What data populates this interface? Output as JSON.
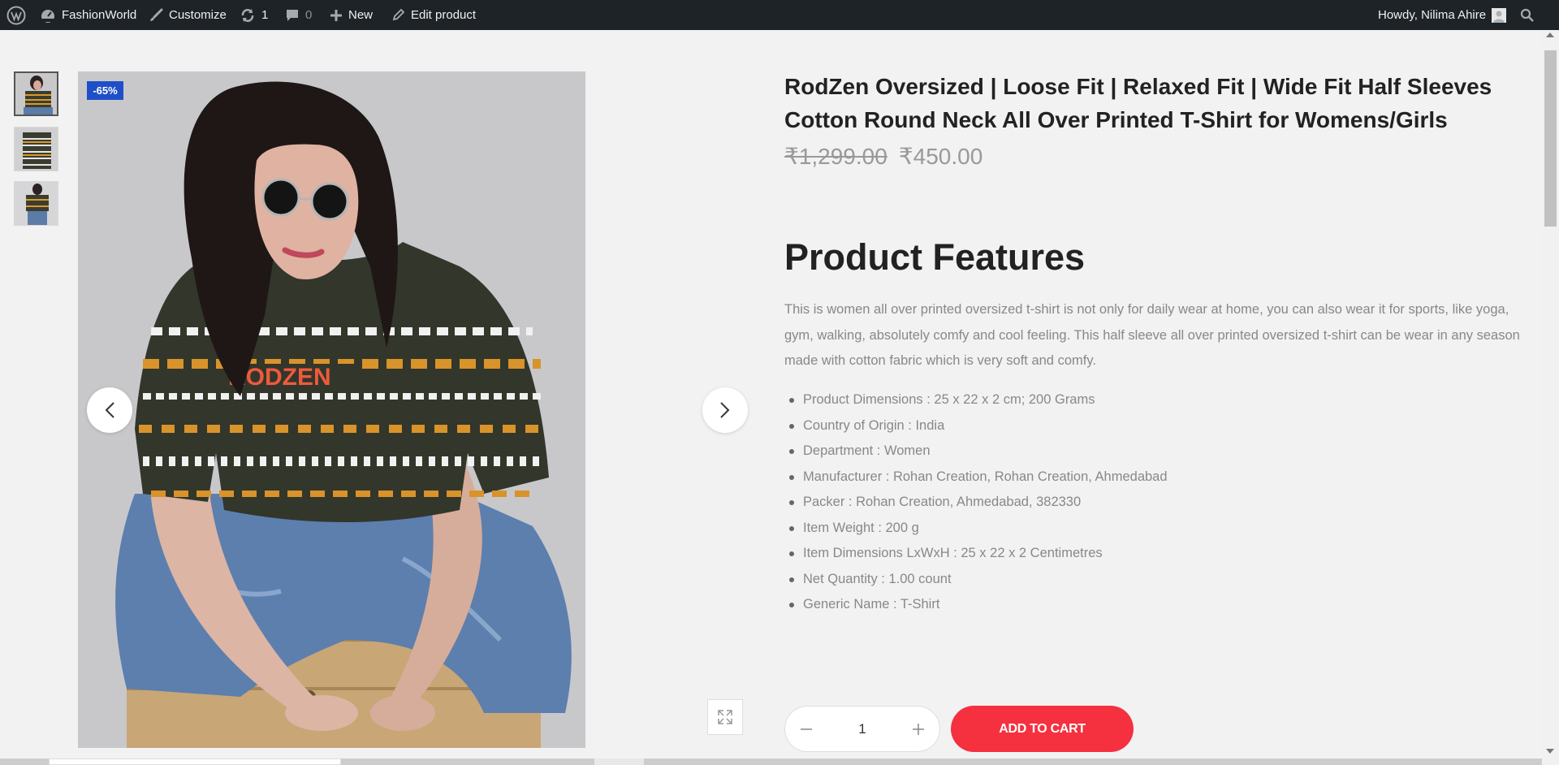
{
  "adminbar": {
    "site_name": "FashionWorld",
    "customize": "Customize",
    "updates_count": "1",
    "comments_count": "0",
    "new_label": "New",
    "edit_label": "Edit product",
    "howdy": "Howdy, Nilima Ahire"
  },
  "gallery": {
    "discount_badge": "-65%"
  },
  "product": {
    "title_line1": "RodZen Oversized | Loose Fit | Relaxed Fit | Wide Fit Half Sleeves",
    "title_line2": "Cotton Round Neck All Over Printed T-Shirt for Womens/Girls",
    "price_old": "₹1,299.00",
    "price_new": "₹450.00",
    "features_heading": "Product Features",
    "description": "This is women all over printed oversized t-shirt is not only for daily wear at home, you can also wear it for sports, like yoga, gym, walking, absolutely comfy and cool feeling. This half sleeve all over printed oversized t-shirt can be wear in any season made with cotton fabric which is very soft and comfy.",
    "specs": [
      "Product Dimensions  :  25 x 22 x 2 cm; 200 Grams",
      "Country of Origin  :  India",
      "Department  :  Women",
      "Manufacturer  :  Rohan Creation, Rohan Creation, Ahmedabad",
      "Packer  :  Rohan Creation, Ahmedabad, 382330",
      "Item Weight  :  200 g",
      "Item Dimensions LxWxH  :  25 x 22 x 2 Centimetres",
      "Net Quantity  :  1.00 count",
      "Generic Name  :  T-Shirt"
    ],
    "quantity": "1",
    "add_to_cart": "ADD TO CART"
  },
  "colors": {
    "adminbar_bg": "#1d2327",
    "badge_bg": "#1f4fc8",
    "cart_button": "#f5303f",
    "page_bg": "#f2f2f2"
  }
}
